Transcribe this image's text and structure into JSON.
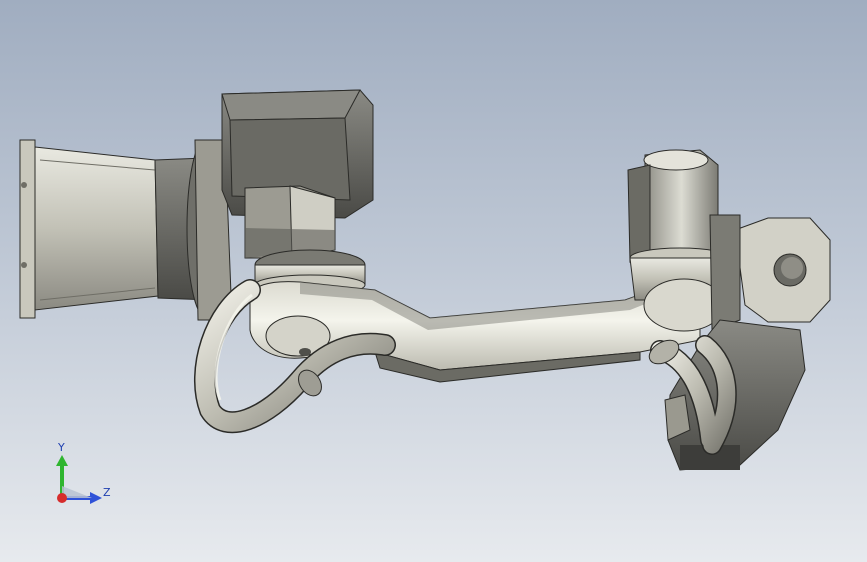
{
  "viewport": {
    "background_top": "#a0adc0",
    "background_bottom": "#e7eaee"
  },
  "model": {
    "description_icon": "robot-arm-model",
    "colors": {
      "body": "#bebdb2",
      "body_dark": "#6b6b64",
      "body_shadow": "#4f4f4a",
      "highlight": "#eeeee6",
      "pipe": "#c9c8be",
      "edge": "#2b2b28"
    }
  },
  "triad": {
    "y_label": "Y",
    "z_label": "Z",
    "colors": {
      "y_axis": "#2fb52f",
      "z_axis": "#2f52d8",
      "x_axis": "#d62c2c"
    }
  }
}
